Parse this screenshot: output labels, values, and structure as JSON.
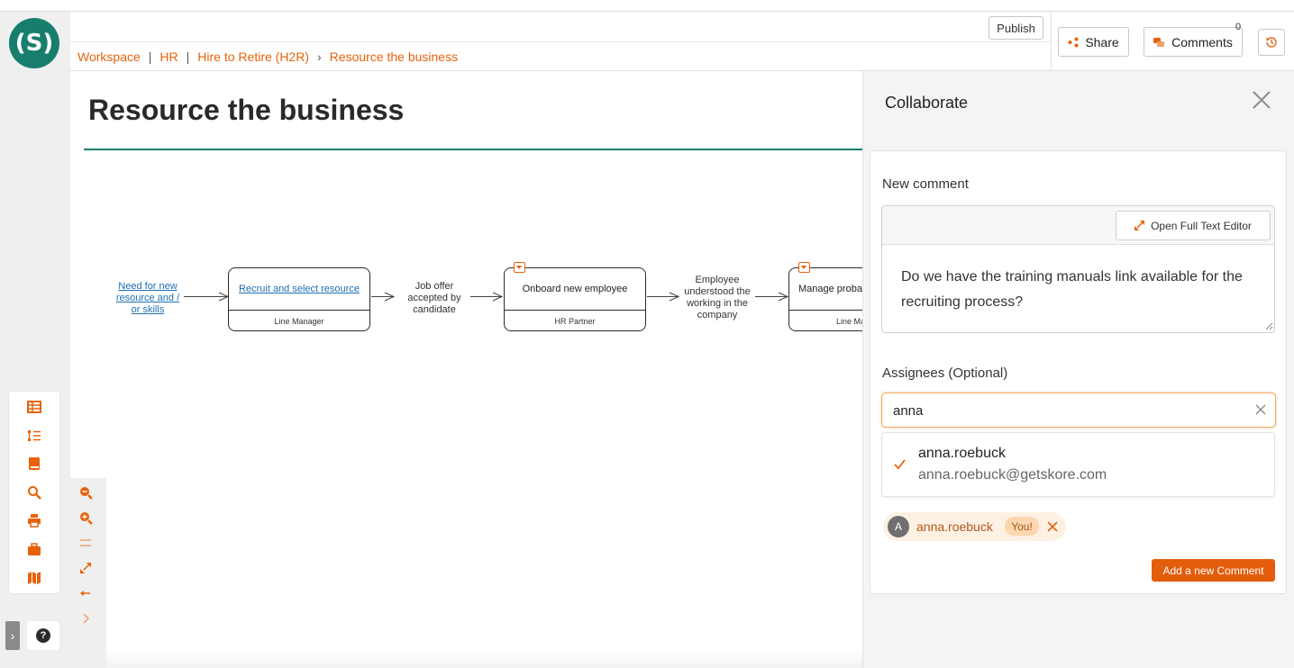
{
  "app": {
    "logo_text": "(S)",
    "accent": "#e8620c",
    "brand": "#177e6e"
  },
  "breadcrumb": {
    "items": [
      "Workspace",
      "HR",
      "Hire to Retire (H2R)",
      "Resource the business"
    ],
    "separators": [
      "|",
      "|",
      "›"
    ]
  },
  "header": {
    "publish_label": "Publish",
    "share_label": "Share",
    "comments_label": "Comments",
    "comments_count": "0"
  },
  "page": {
    "title": "Resource the business"
  },
  "diagram": {
    "start_event": [
      "Need for new",
      "resource and /",
      "or skills"
    ],
    "nodes": [
      {
        "title": "Recruit and select resource",
        "role": "Line Manager"
      },
      {
        "title": "Onboard new employee",
        "role": "HR Partner"
      },
      {
        "title": "Manage proba",
        "role": "Line Ma"
      }
    ],
    "events": [
      [
        "Job offer",
        "accepted by",
        "candidate"
      ],
      [
        "Employee",
        "understood the",
        "working in the",
        "company"
      ]
    ]
  },
  "collaborate": {
    "title": "Collaborate",
    "new_comment_label": "New comment",
    "open_editor_label": "Open Full Text Editor",
    "comment_text": "Do we have the training manuals link available for the recruiting process?",
    "assignees_label": "Assignees (Optional)",
    "assignee_search_value": "anna",
    "suggestion": {
      "username": "anna.roebuck",
      "email": "anna.roebuck@getskore.com"
    },
    "selected_chip": {
      "avatar_letter": "A",
      "name": "anna.roebuck",
      "badge": "You!"
    },
    "add_button_label": "Add a new Comment"
  },
  "icons": {
    "left_tools": [
      "table-icon",
      "tree-list-icon",
      "book-icon",
      "search-icon",
      "print-icon",
      "briefcase-icon",
      "map-icon"
    ],
    "zoom_tools": [
      "zoom-out-icon",
      "zoom-in-icon",
      "equals-icon",
      "fit-screen-icon",
      "arrows-horizontal-icon",
      "chevron-right-icon"
    ]
  }
}
